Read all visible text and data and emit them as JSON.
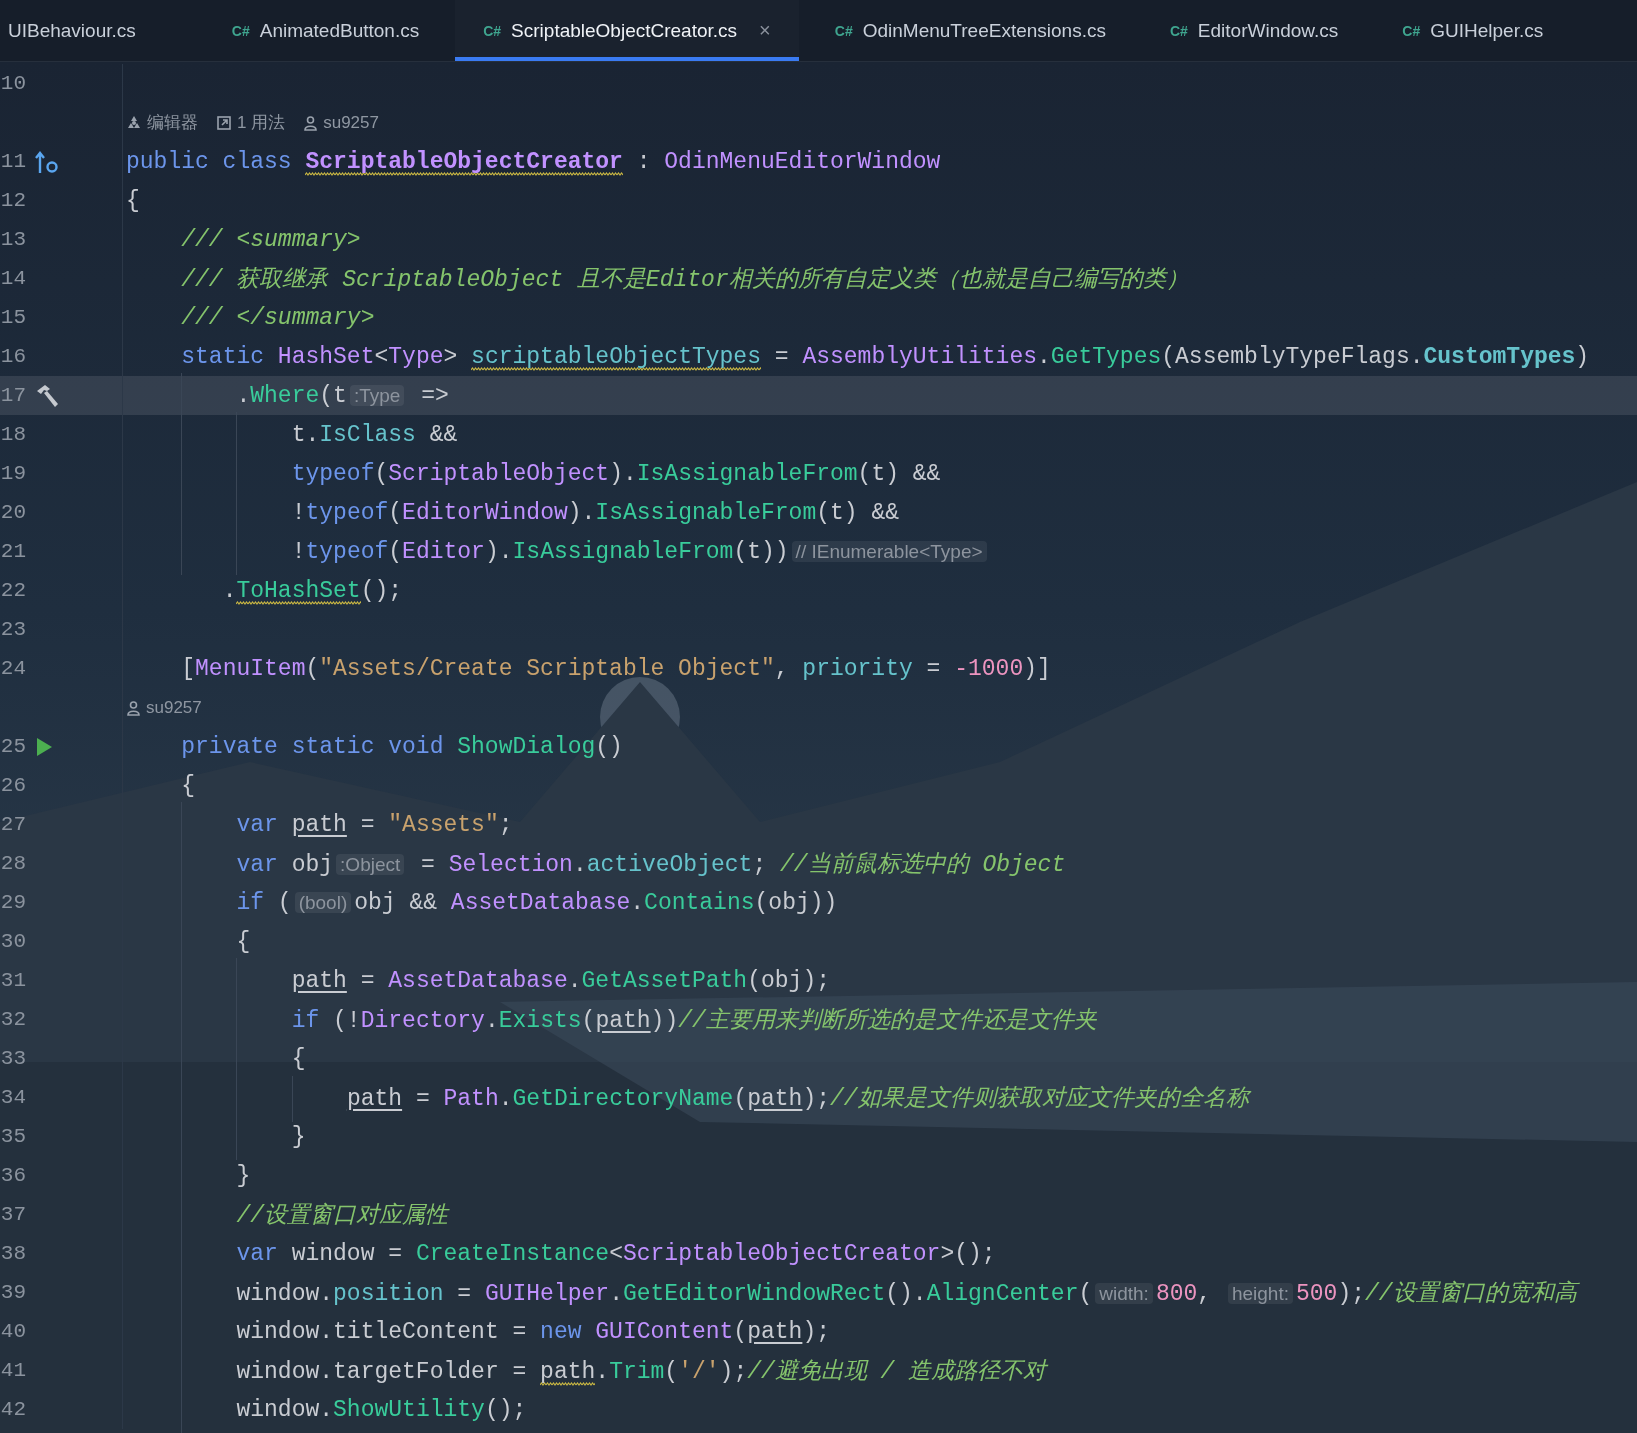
{
  "tabs": [
    {
      "label": "UIBehaviour.cs",
      "selected": false,
      "closable": false
    },
    {
      "label": "AnimatedButton.cs",
      "badge": "C#",
      "selected": false,
      "closable": false
    },
    {
      "label": "ScriptableObjectCreator.cs",
      "badge": "C#",
      "selected": true,
      "closable": true,
      "close": "×"
    },
    {
      "label": "OdinMenuTreeExtensions.cs",
      "badge": "C#",
      "selected": false,
      "closable": false
    },
    {
      "label": "EditorWindow.cs",
      "badge": "C#",
      "selected": false,
      "closable": false
    },
    {
      "label": "GUIHelper.cs",
      "badge": "C#",
      "selected": false,
      "closable": false
    }
  ],
  "rows": [
    {
      "kind": "code",
      "number": "10",
      "indent": "",
      "current": false,
      "tokens": []
    },
    {
      "kind": "lens",
      "items": [
        {
          "kind": "editor",
          "text": "编辑器"
        },
        {
          "kind": "usages",
          "text": "1 用法"
        },
        {
          "kind": "author",
          "text": "su9257"
        }
      ]
    },
    {
      "kind": "code",
      "number": "11",
      "indent": "",
      "current": false,
      "gutter": {
        "kind": "implements"
      },
      "tokens": [
        {
          "kind": "kw",
          "text": "public class "
        },
        {
          "kind": "decl_warn",
          "text": "ScriptableObjectCreator"
        },
        {
          "kind": "plain",
          "text": " : "
        },
        {
          "kind": "type",
          "text": "OdinMenuEditorWindow"
        }
      ]
    },
    {
      "kind": "code",
      "number": "12",
      "indent": "",
      "current": false,
      "tokens": [
        {
          "kind": "plain",
          "text": "{"
        }
      ]
    },
    {
      "kind": "code",
      "number": "13",
      "indent": "    ",
      "current": false,
      "tokens": [
        {
          "kind": "doc",
          "text": "/// <summary>"
        }
      ]
    },
    {
      "kind": "code",
      "number": "14",
      "indent": "    ",
      "current": false,
      "tokens": [
        {
          "kind": "doc",
          "text": "/// 获取继承 ScriptableObject 且不是Editor相关的所有自定义类（也就是自己编写的类）"
        }
      ]
    },
    {
      "kind": "code",
      "number": "15",
      "indent": "    ",
      "current": false,
      "tokens": [
        {
          "kind": "doc",
          "text": "/// </summary>"
        }
      ]
    },
    {
      "kind": "code",
      "number": "16",
      "indent": "    ",
      "current": false,
      "tokens": [
        {
          "kind": "kw",
          "text": "static "
        },
        {
          "kind": "type",
          "text": "HashSet"
        },
        {
          "kind": "plain",
          "text": "<"
        },
        {
          "kind": "type",
          "text": "Type"
        },
        {
          "kind": "plain",
          "text": "> "
        },
        {
          "kind": "field_warn",
          "text": "scriptableObjectTypes"
        },
        {
          "kind": "plain",
          "text": " = "
        },
        {
          "kind": "type",
          "text": "AssemblyUtilities"
        },
        {
          "kind": "plain",
          "text": "."
        },
        {
          "kind": "method",
          "text": "GetTypes"
        },
        {
          "kind": "plain",
          "text": "(AssemblyTypeFlags."
        },
        {
          "kind": "static_field",
          "text": "CustomTypes"
        },
        {
          "kind": "plain",
          "text": ")"
        }
      ]
    },
    {
      "kind": "code",
      "number": "17",
      "indent": "        ",
      "current": true,
      "gutter": {
        "kind": "hammer"
      },
      "tokens": [
        {
          "kind": "plain",
          "text": "."
        },
        {
          "kind": "method",
          "text": "Where"
        },
        {
          "kind": "plain",
          "text": "(t"
        },
        {
          "kind": "hint",
          "text": ":Type"
        },
        {
          "kind": "plain",
          "text": " =>"
        }
      ]
    },
    {
      "kind": "code",
      "number": "18",
      "indent": "            ",
      "current": false,
      "tokens": [
        {
          "kind": "plain",
          "text": "t."
        },
        {
          "kind": "field",
          "text": "IsClass"
        },
        {
          "kind": "plain",
          "text": " &&"
        }
      ]
    },
    {
      "kind": "code",
      "number": "19",
      "indent": "            ",
      "current": false,
      "tokens": [
        {
          "kind": "kw",
          "text": "typeof"
        },
        {
          "kind": "plain",
          "text": "("
        },
        {
          "kind": "type",
          "text": "ScriptableObject"
        },
        {
          "kind": "plain",
          "text": ")."
        },
        {
          "kind": "method",
          "text": "IsAssignableFrom"
        },
        {
          "kind": "plain",
          "text": "(t) &&"
        }
      ]
    },
    {
      "kind": "code",
      "number": "20",
      "indent": "            ",
      "current": false,
      "tokens": [
        {
          "kind": "plain",
          "text": "!"
        },
        {
          "kind": "kw",
          "text": "typeof"
        },
        {
          "kind": "plain",
          "text": "("
        },
        {
          "kind": "type",
          "text": "EditorWindow"
        },
        {
          "kind": "plain",
          "text": ")."
        },
        {
          "kind": "method",
          "text": "IsAssignableFrom"
        },
        {
          "kind": "plain",
          "text": "(t) &&"
        }
      ]
    },
    {
      "kind": "code",
      "number": "21",
      "indent": "            ",
      "current": false,
      "tokens": [
        {
          "kind": "plain",
          "text": "!"
        },
        {
          "kind": "kw",
          "text": "typeof"
        },
        {
          "kind": "plain",
          "text": "("
        },
        {
          "kind": "type",
          "text": "Editor"
        },
        {
          "kind": "plain",
          "text": ")."
        },
        {
          "kind": "method",
          "text": "IsAssignableFrom"
        },
        {
          "kind": "plain",
          "text": "(t))"
        },
        {
          "kind": "hint",
          "text": "// IEnumerable<Type>"
        }
      ]
    },
    {
      "kind": "code",
      "number": "22",
      "indent": "       ",
      "current": false,
      "tokens": [
        {
          "kind": "plain",
          "text": "."
        },
        {
          "kind": "method_warn",
          "text": "ToHashSet"
        },
        {
          "kind": "plain",
          "text": "();"
        }
      ]
    },
    {
      "kind": "code",
      "number": "23",
      "indent": "",
      "current": false,
      "tokens": []
    },
    {
      "kind": "code",
      "number": "24",
      "indent": "    ",
      "current": false,
      "tokens": [
        {
          "kind": "plain",
          "text": "["
        },
        {
          "kind": "type",
          "text": "MenuItem"
        },
        {
          "kind": "plain",
          "text": "("
        },
        {
          "kind": "str",
          "text": "\"Assets/Create Scriptable Object\""
        },
        {
          "kind": "plain",
          "text": ", "
        },
        {
          "kind": "field",
          "text": "priority"
        },
        {
          "kind": "plain",
          "text": " = "
        },
        {
          "kind": "num",
          "text": "-1000"
        },
        {
          "kind": "plain",
          "text": ")]"
        }
      ]
    },
    {
      "kind": "lens",
      "items": [
        {
          "kind": "author",
          "text": "su9257"
        }
      ]
    },
    {
      "kind": "code",
      "number": "25",
      "indent": "    ",
      "current": false,
      "gutter": {
        "kind": "run"
      },
      "tokens": [
        {
          "kind": "kw",
          "text": "private static void "
        },
        {
          "kind": "method",
          "text": "ShowDialog"
        },
        {
          "kind": "plain",
          "text": "()"
        }
      ]
    },
    {
      "kind": "code",
      "number": "26",
      "indent": "    ",
      "current": false,
      "tokens": [
        {
          "kind": "plain",
          "text": "{"
        }
      ]
    },
    {
      "kind": "code",
      "number": "27",
      "indent": "        ",
      "current": false,
      "tokens": [
        {
          "kind": "kw",
          "text": "var "
        },
        {
          "kind": "var_mutable",
          "text": "path"
        },
        {
          "kind": "plain",
          "text": " = "
        },
        {
          "kind": "str",
          "text": "\"Assets\""
        },
        {
          "kind": "plain",
          "text": ";"
        }
      ]
    },
    {
      "kind": "code",
      "number": "28",
      "indent": "        ",
      "current": false,
      "tokens": [
        {
          "kind": "kw",
          "text": "var "
        },
        {
          "kind": "plain",
          "text": "obj"
        },
        {
          "kind": "hint",
          "text": ":Object"
        },
        {
          "kind": "plain",
          "text": " = "
        },
        {
          "kind": "type",
          "text": "Selection"
        },
        {
          "kind": "plain",
          "text": "."
        },
        {
          "kind": "field",
          "text": "activeObject"
        },
        {
          "kind": "plain",
          "text": "; "
        },
        {
          "kind": "comment",
          "text": "//当前鼠标选中的 Object"
        }
      ]
    },
    {
      "kind": "code",
      "number": "29",
      "indent": "        ",
      "current": false,
      "tokens": [
        {
          "kind": "kw",
          "text": "if"
        },
        {
          "kind": "plain",
          "text": " ("
        },
        {
          "kind": "hint",
          "text": "(bool)"
        },
        {
          "kind": "plain",
          "text": "obj && "
        },
        {
          "kind": "type",
          "text": "AssetDatabase"
        },
        {
          "kind": "plain",
          "text": "."
        },
        {
          "kind": "method",
          "text": "Contains"
        },
        {
          "kind": "plain",
          "text": "(obj))"
        }
      ]
    },
    {
      "kind": "code",
      "number": "30",
      "indent": "        ",
      "current": false,
      "tokens": [
        {
          "kind": "plain",
          "text": "{"
        }
      ]
    },
    {
      "kind": "code",
      "number": "31",
      "indent": "            ",
      "current": false,
      "tokens": [
        {
          "kind": "var_mutable",
          "text": "path"
        },
        {
          "kind": "plain",
          "text": " = "
        },
        {
          "kind": "type",
          "text": "AssetDatabase"
        },
        {
          "kind": "plain",
          "text": "."
        },
        {
          "kind": "method",
          "text": "GetAssetPath"
        },
        {
          "kind": "plain",
          "text": "(obj);"
        }
      ]
    },
    {
      "kind": "code",
      "number": "32",
      "indent": "            ",
      "current": false,
      "tokens": [
        {
          "kind": "kw",
          "text": "if"
        },
        {
          "kind": "plain",
          "text": " (!"
        },
        {
          "kind": "type",
          "text": "Directory"
        },
        {
          "kind": "plain",
          "text": "."
        },
        {
          "kind": "method",
          "text": "Exists"
        },
        {
          "kind": "plain",
          "text": "("
        },
        {
          "kind": "var_mutable",
          "text": "path"
        },
        {
          "kind": "plain",
          "text": "))"
        },
        {
          "kind": "comment",
          "text": "//主要用来判断所选的是文件还是文件夹"
        }
      ]
    },
    {
      "kind": "code",
      "number": "33",
      "indent": "            ",
      "current": false,
      "tokens": [
        {
          "kind": "plain",
          "text": "{"
        }
      ]
    },
    {
      "kind": "code",
      "number": "34",
      "indent": "                ",
      "current": false,
      "tokens": [
        {
          "kind": "var_mutable",
          "text": "path"
        },
        {
          "kind": "plain",
          "text": " = "
        },
        {
          "kind": "type",
          "text": "Path"
        },
        {
          "kind": "plain",
          "text": "."
        },
        {
          "kind": "method",
          "text": "GetDirectoryName"
        },
        {
          "kind": "plain",
          "text": "("
        },
        {
          "kind": "var_mutable",
          "text": "path"
        },
        {
          "kind": "plain",
          "text": ");"
        },
        {
          "kind": "comment",
          "text": "//如果是文件则获取对应文件夹的全名称"
        }
      ]
    },
    {
      "kind": "code",
      "number": "35",
      "indent": "            ",
      "current": false,
      "tokens": [
        {
          "kind": "plain",
          "text": "}"
        }
      ]
    },
    {
      "kind": "code",
      "number": "36",
      "indent": "        ",
      "current": false,
      "tokens": [
        {
          "kind": "plain",
          "text": "}"
        }
      ]
    },
    {
      "kind": "code",
      "number": "37",
      "indent": "        ",
      "current": false,
      "tokens": [
        {
          "kind": "comment",
          "text": "//设置窗口对应属性"
        }
      ]
    },
    {
      "kind": "code",
      "number": "38",
      "indent": "        ",
      "current": false,
      "tokens": [
        {
          "kind": "kw",
          "text": "var "
        },
        {
          "kind": "plain",
          "text": "window = "
        },
        {
          "kind": "method",
          "text": "CreateInstance"
        },
        {
          "kind": "plain",
          "text": "<"
        },
        {
          "kind": "type",
          "text": "ScriptableObjectCreator"
        },
        {
          "kind": "plain",
          "text": ">();"
        }
      ]
    },
    {
      "kind": "code",
      "number": "39",
      "indent": "        ",
      "current": false,
      "tokens": [
        {
          "kind": "plain",
          "text": "window."
        },
        {
          "kind": "field",
          "text": "position"
        },
        {
          "kind": "plain",
          "text": " = "
        },
        {
          "kind": "type",
          "text": "GUIHelper"
        },
        {
          "kind": "plain",
          "text": "."
        },
        {
          "kind": "method",
          "text": "GetEditorWindowRect"
        },
        {
          "kind": "plain",
          "text": "()."
        },
        {
          "kind": "method",
          "text": "AlignCenter"
        },
        {
          "kind": "plain",
          "text": "("
        },
        {
          "kind": "hint",
          "text": "width:"
        },
        {
          "kind": "num",
          "text": "800"
        },
        {
          "kind": "plain",
          "text": ", "
        },
        {
          "kind": "hint",
          "text": "height:"
        },
        {
          "kind": "num",
          "text": "500"
        },
        {
          "kind": "plain",
          "text": ");"
        },
        {
          "kind": "comment",
          "text": "//设置窗口的宽和高"
        }
      ]
    },
    {
      "kind": "code",
      "number": "40",
      "indent": "        ",
      "current": false,
      "tokens": [
        {
          "kind": "plain",
          "text": "window.titleContent = "
        },
        {
          "kind": "kw",
          "text": "new "
        },
        {
          "kind": "type",
          "text": "GUIContent"
        },
        {
          "kind": "plain",
          "text": "("
        },
        {
          "kind": "var_mutable",
          "text": "path"
        },
        {
          "kind": "plain",
          "text": ");"
        }
      ]
    },
    {
      "kind": "code",
      "number": "41",
      "indent": "        ",
      "current": false,
      "tokens": [
        {
          "kind": "plain",
          "text": "window.targetFolder = "
        },
        {
          "kind": "var_warn",
          "text": "path"
        },
        {
          "kind": "member_call",
          "text": ".Trim"
        },
        {
          "kind": "plain",
          "text": "("
        },
        {
          "kind": "str",
          "text": "'/'"
        },
        {
          "kind": "plain",
          "text": ");"
        },
        {
          "kind": "comment",
          "text": "//避免出现 / 造成路径不对"
        }
      ]
    },
    {
      "kind": "code",
      "number": "42",
      "indent": "        ",
      "current": false,
      "tokens": [
        {
          "kind": "plain",
          "text": "window."
        },
        {
          "kind": "method",
          "text": "ShowUtility"
        },
        {
          "kind": "plain",
          "text": "();"
        }
      ]
    }
  ]
}
